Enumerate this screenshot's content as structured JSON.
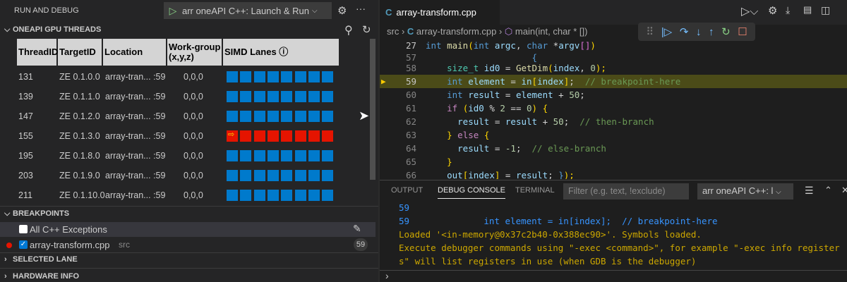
{
  "sidebar": {
    "title": "RUN AND DEBUG",
    "launch_config": "arr oneAPI C++: Launch & Run",
    "threads_section": "ONEAPI GPU THREADS",
    "columns": [
      "ThreadID",
      "TargetID",
      "Location",
      "Work-group (x,y,z)",
      "SIMD Lanes ⓘ"
    ],
    "rows": [
      {
        "thread": "131",
        "target": "ZE 0.1.0.0",
        "location": "array-tran... :59",
        "wg": "0,0,0",
        "lanes": "active"
      },
      {
        "thread": "139",
        "target": "ZE 0.1.1.0",
        "location": "array-tran... :59",
        "wg": "0,0,0",
        "lanes": "active"
      },
      {
        "thread": "147",
        "target": "ZE 0.1.2.0",
        "location": "array-tran... :59",
        "wg": "0,0,0",
        "lanes": "active"
      },
      {
        "thread": "155",
        "target": "ZE 0.1.3.0",
        "location": "array-tran... :59",
        "wg": "0,0,0",
        "lanes": "current"
      },
      {
        "thread": "195",
        "target": "ZE 0.1.8.0",
        "location": "array-tran... :59",
        "wg": "0,0,0",
        "lanes": "active"
      },
      {
        "thread": "203",
        "target": "ZE 0.1.9.0",
        "location": "array-tran... :59",
        "wg": "0,0,0",
        "lanes": "active"
      },
      {
        "thread": "211",
        "target": "ZE 0.1.10.0",
        "location": "array-tran... :59",
        "wg": "0,0,0",
        "lanes": "active"
      }
    ],
    "lane_count": 8,
    "lane_colors": {
      "active": "#007acc",
      "current": "#e51400",
      "marker": "#ffd700"
    },
    "breakpoints_section": "BREAKPOINTS",
    "bp_exceptions": "All C++ Exceptions",
    "bp_file": "array-transform.cpp",
    "bp_dir": "src",
    "bp_line": "59",
    "selected_lane": "SELECTED LANE",
    "hardware_info": "HARDWARE INFO"
  },
  "editor": {
    "tab": "array-transform.cpp",
    "breadcrumb": [
      "src",
      "array-transform.cpp",
      "main(int, char * [])"
    ],
    "lines": [
      {
        "n": "27",
        "tokens": [
          [
            "int ",
            "k"
          ],
          [
            "main",
            "f"
          ],
          [
            "(",
            "y"
          ],
          [
            "int ",
            "k"
          ],
          [
            "argc",
            "v"
          ],
          [
            ", ",
            "o"
          ],
          [
            "char ",
            "k"
          ],
          [
            "*",
            "o"
          ],
          [
            "argv",
            "v"
          ],
          [
            "[]",
            "m"
          ],
          [
            ")",
            "y"
          ]
        ]
      },
      {
        "n": "57",
        "tokens": [
          [
            "                    {",
            "k"
          ]
        ]
      },
      {
        "n": "58",
        "tokens": [
          [
            "    ",
            "o"
          ],
          [
            "size_t ",
            "t"
          ],
          [
            "id0",
            "v"
          ],
          [
            " = ",
            "o"
          ],
          [
            "GetDim",
            "f"
          ],
          [
            "(",
            "y"
          ],
          [
            "index",
            "v"
          ],
          [
            ", ",
            "o"
          ],
          [
            "0",
            "n"
          ],
          [
            ");",
            "y"
          ]
        ]
      },
      {
        "n": "59",
        "tokens": [
          [
            "    ",
            "o"
          ],
          [
            "int ",
            "k"
          ],
          [
            "element",
            "v"
          ],
          [
            " = ",
            "o"
          ],
          [
            "in",
            "v"
          ],
          [
            "[",
            "y"
          ],
          [
            "index",
            "v"
          ],
          [
            "]",
            "y"
          ],
          [
            ";  ",
            "o"
          ],
          [
            "// breakpoint-here",
            "c"
          ]
        ]
      },
      {
        "n": "60",
        "tokens": [
          [
            "    ",
            "o"
          ],
          [
            "int ",
            "k"
          ],
          [
            "result",
            "v"
          ],
          [
            " = ",
            "o"
          ],
          [
            "element",
            "v"
          ],
          [
            " + ",
            "o"
          ],
          [
            "50",
            "n"
          ],
          [
            ";",
            "o"
          ]
        ]
      },
      {
        "n": "61",
        "tokens": [
          [
            "    ",
            "o"
          ],
          [
            "if ",
            "p"
          ],
          [
            "(",
            "y"
          ],
          [
            "id0",
            "v"
          ],
          [
            " % ",
            "o"
          ],
          [
            "2",
            "n"
          ],
          [
            " == ",
            "o"
          ],
          [
            "0",
            "n"
          ],
          [
            ") {",
            "y"
          ]
        ]
      },
      {
        "n": "62",
        "tokens": [
          [
            "      ",
            "o"
          ],
          [
            "result",
            "v"
          ],
          [
            " = ",
            "o"
          ],
          [
            "result",
            "v"
          ],
          [
            " + ",
            "o"
          ],
          [
            "50",
            "n"
          ],
          [
            ";  ",
            "o"
          ],
          [
            "// then-branch",
            "c"
          ]
        ]
      },
      {
        "n": "63",
        "tokens": [
          [
            "    ",
            "o"
          ],
          [
            "} ",
            "y"
          ],
          [
            "else ",
            "p"
          ],
          [
            "{",
            "y"
          ]
        ]
      },
      {
        "n": "64",
        "tokens": [
          [
            "      ",
            "o"
          ],
          [
            "result",
            "v"
          ],
          [
            " = ",
            "o"
          ],
          [
            "-1",
            "n"
          ],
          [
            ";  ",
            "o"
          ],
          [
            "// else-branch",
            "c"
          ]
        ]
      },
      {
        "n": "65",
        "tokens": [
          [
            "    ",
            "o"
          ],
          [
            "}",
            "y"
          ]
        ]
      },
      {
        "n": "66",
        "tokens": [
          [
            "    ",
            "o"
          ],
          [
            "out",
            "v"
          ],
          [
            "[",
            "y"
          ],
          [
            "index",
            "v"
          ],
          [
            "]",
            "y"
          ],
          [
            " = ",
            "o"
          ],
          [
            "result",
            "v"
          ],
          [
            "; ",
            "o"
          ],
          [
            "}",
            "k"
          ],
          [
            ");",
            "y"
          ]
        ]
      }
    ]
  },
  "panel": {
    "tabs": [
      "OUTPUT",
      "DEBUG CONSOLE",
      "TERMINAL"
    ],
    "active_tab": "DEBUG CONSOLE",
    "filter_placeholder": "Filter (e.g. text, !exclude)",
    "session": "arr oneAPI C++: l",
    "console": [
      {
        "text": "59",
        "color": "#3794ff"
      },
      {
        "text": "59              int element = in[index];  // breakpoint-here",
        "color": "#3794ff"
      },
      {
        "text": "Loaded '<in-memory@0x37c2b40-0x388ec90>'. Symbols loaded.",
        "color": "#cca700"
      },
      {
        "text": "Execute debugger commands using \"-exec <command>\", for example \"-exec info register",
        "color": "#cca700"
      },
      {
        "text": "s\" will list registers in use (when GDB is the debugger)",
        "color": "#cca700"
      }
    ]
  }
}
